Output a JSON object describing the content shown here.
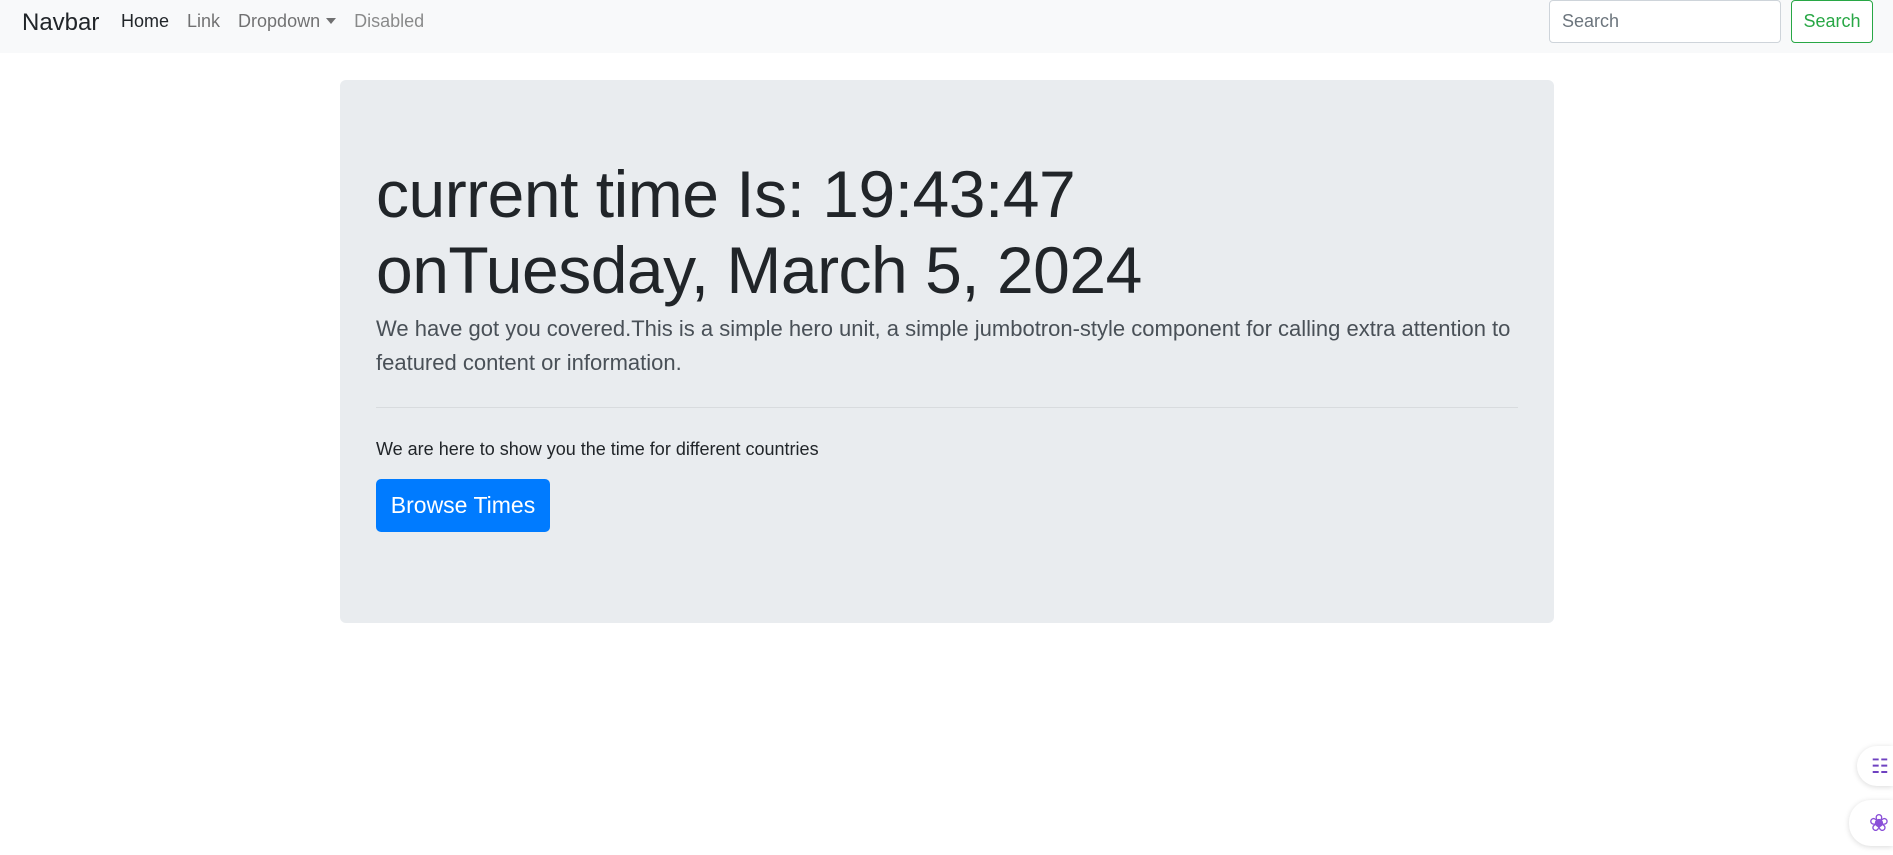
{
  "navbar": {
    "brand": "Navbar",
    "links": [
      {
        "label": "Home",
        "state": "active"
      },
      {
        "label": "Link",
        "state": "normal"
      },
      {
        "label": "Dropdown",
        "state": "dropdown"
      },
      {
        "label": "Disabled",
        "state": "disabled"
      }
    ],
    "search": {
      "placeholder": "Search",
      "value": "",
      "button_label": "Search"
    }
  },
  "jumbotron": {
    "heading_line1": "current time Is: 19:43:47",
    "heading_line2": "onTuesday, March 5, 2024",
    "lead": "We have got you covered.This is a simple hero unit, a simple jumbotron-style component for calling extra attention to featured content or information.",
    "subtext": "We are here to show you the time for different countries",
    "button_label": "Browse Times"
  },
  "colors": {
    "navbar_bg": "#f8f9fa",
    "jumbotron_bg": "#e9ecef",
    "primary": "#007bff",
    "success": "#28a745"
  },
  "floating_widgets": [
    {
      "icon": "translate-icon"
    },
    {
      "icon": "brain-icon"
    }
  ]
}
